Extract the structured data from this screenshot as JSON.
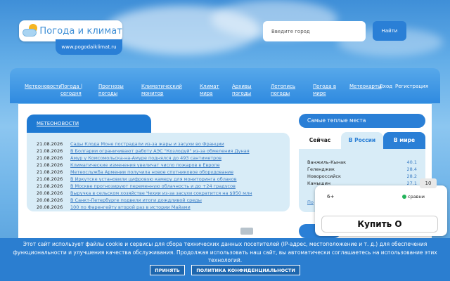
{
  "header": {
    "logo_text": "Погода и климат",
    "site_url": "www.pogodaiklimat.ru",
    "search_placeholder": "Введите город",
    "search_button": "Найти"
  },
  "nav": {
    "items": [
      {
        "label": "Метеоновости",
        "url": false
      },
      {
        "label": "Погода | сегодня"
      },
      {
        "label": "Прогнозы погоды"
      },
      {
        "label": "Климатический монитор"
      },
      {
        "label": "Климат мира"
      },
      {
        "label": "Архивы погоды"
      },
      {
        "label": "Летопись погоды"
      },
      {
        "label": "Погода в мире"
      },
      {
        "label": "Метеокарты"
      },
      {
        "label": "Вход"
      },
      {
        "label": "Регистрация"
      }
    ]
  },
  "news": {
    "header": "МЕТЕОНОВОСТИ",
    "items": [
      {
        "date": "21.08.2026",
        "title": "Сады Клода Моне пострадали из-за жары и засухи во Франции"
      },
      {
        "date": "21.08.2026",
        "title": "В Болгарии ограничивают работу АЭС \"Козлодуй\" из-за обмеления Дуная"
      },
      {
        "date": "21.08.2026",
        "title": "Амур у Комсомольска-на-Амуре поднялся до 493 сантиметров"
      },
      {
        "date": "21.08.2026",
        "title": "Климатические изменения увеличат число пожаров в Европе"
      },
      {
        "date": "21.08.2026",
        "title": "Метеослужба Армении получила новое спутниковое оборудование"
      },
      {
        "date": "21.08.2026",
        "title": "В Иркутске установили цифровую камеру для мониторинга облаков"
      },
      {
        "date": "21.08.2026",
        "title": "В Москве прогнозируют переменную облачность и до +24 градусов"
      },
      {
        "date": "20.08.2026",
        "title": "Выручка в сельском хозяйстве Чехии из-за засухи сократится на $950 млн"
      },
      {
        "date": "20.08.2026",
        "title": "В Санкт-Петербурге подвели итоги дождливой среды"
      },
      {
        "date": "20.08.2026",
        "title": "100 по Фаренгейту второй раз в истории Майами"
      }
    ]
  },
  "warm_places": {
    "header": "Самые теплые места",
    "tabs": [
      "Сейчас",
      "В России",
      "В мире"
    ],
    "rows": [
      {
        "city": "Ванжиль-Кынак",
        "value": "40.1"
      },
      {
        "city": "Геленджик",
        "value": "28.4"
      },
      {
        "city": "Новороссийск",
        "value": "28.2"
      },
      {
        "city": "Камышин",
        "value": "27.1"
      }
    ],
    "more_link": "По"
  },
  "ad": {
    "age": "6+",
    "brand": "сравни",
    "button": "Купить О",
    "timer": "10"
  },
  "cookie": {
    "text": "Этот сайт использует файлы cookie и сервисы для сбора технических данных посетителей (IP-адрес, местоположение и т. д.) для обеспечения функциональности и улучшения качества обслуживания. Продолжая использовать наш сайт, вы автоматически соглашаетесь на использование этих технологий.",
    "accept": "ПРИНЯТЬ",
    "policy": "ПОЛИТИКА КОНФИДЕНЦИАЛЬНОСТИ"
  }
}
